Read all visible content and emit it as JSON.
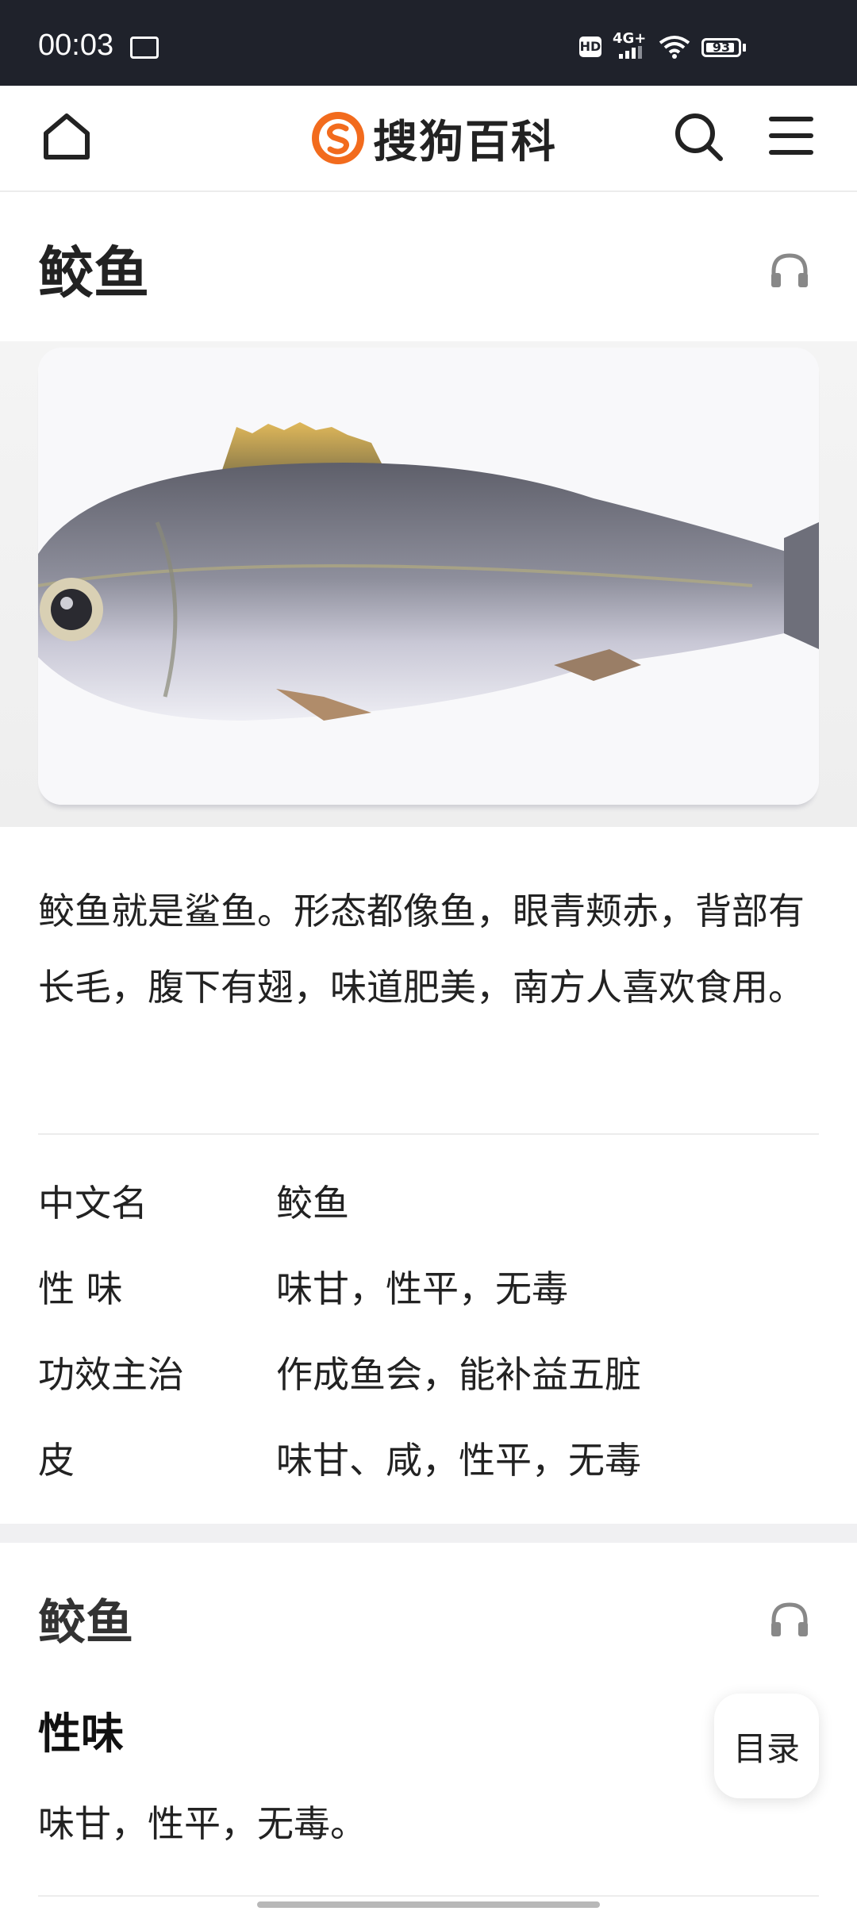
{
  "status_bar": {
    "time": "00:03",
    "carrier_badge": "iQIY",
    "hd": "HD",
    "network": "4G+",
    "battery": "93",
    "battery_level": 0.93
  },
  "top_bar": {
    "logo_text": "搜狗百科",
    "icons": [
      "home-icon",
      "sogou-logo-icon",
      "search-icon",
      "menu-icon"
    ]
  },
  "article": {
    "title": "鲛鱼",
    "summary": "鲛鱼就是鲨鱼。形态都像鱼，眼青颊赤，背部有长毛，腹下有翅，味道肥美，南方人喜欢食用。",
    "info": [
      {
        "key": "中文名",
        "value": "鲛鱼"
      },
      {
        "key": "性 味",
        "value": "味甘，性平，无毒"
      },
      {
        "key": "功效主治",
        "value": "作成鱼会，能补益五脏"
      },
      {
        "key": "皮",
        "value": "味甘、咸，性平，无毒"
      }
    ]
  },
  "section": {
    "title": "鲛鱼",
    "subheading": "性味",
    "paragraph": "味甘，性平，无毒。"
  },
  "toc_button": "目录",
  "colors": {
    "status_bar_bg": "#1f222b",
    "logo_orange": "#f26b1d",
    "text": "#222222"
  }
}
